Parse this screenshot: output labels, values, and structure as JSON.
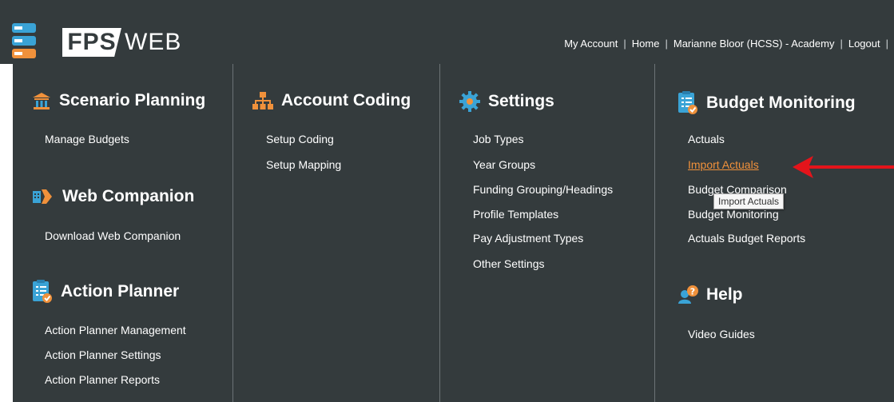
{
  "header": {
    "logo_fps": "FPS",
    "logo_web": "WEB",
    "nav": [
      "My Account",
      "Home",
      "Marianne Bloor (HCSS) - Academy",
      "Logout"
    ]
  },
  "colors": {
    "background": "#343b3d",
    "accent_orange": "#f0913b",
    "icon_blue": "#3aa3d6",
    "arrow_red": "#e4141b"
  },
  "menu": {
    "scenario_planning": {
      "title": "Scenario Planning",
      "icon": "building-icon",
      "items": [
        "Manage Budgets"
      ]
    },
    "web_companion": {
      "title": "Web Companion",
      "icon": "plugin-icon",
      "items": [
        "Download Web Companion"
      ]
    },
    "action_planner": {
      "title": "Action Planner",
      "icon": "checklist-icon",
      "items": [
        "Action Planner Management",
        "Action Planner Settings",
        "Action Planner Reports"
      ]
    },
    "account_coding": {
      "title": "Account Coding",
      "icon": "hierarchy-icon",
      "items": [
        "Setup Coding",
        "Setup Mapping"
      ]
    },
    "settings": {
      "title": "Settings",
      "icon": "gear-icon",
      "items": [
        "Job Types",
        "Year Groups",
        "Funding Grouping/Headings",
        "Profile Templates",
        "Pay Adjustment Types",
        "Other Settings"
      ]
    },
    "budget_monitoring": {
      "title": "Budget Monitoring",
      "icon": "checklist-icon",
      "items": [
        "Actuals",
        "Import Actuals",
        "Budget Comparison",
        "Budget Monitoring",
        "Actuals Budget Reports"
      ]
    },
    "help": {
      "title": "Help",
      "icon": "help-user-icon",
      "items": [
        "Video Guides"
      ]
    }
  },
  "tooltip": "Import Actuals"
}
